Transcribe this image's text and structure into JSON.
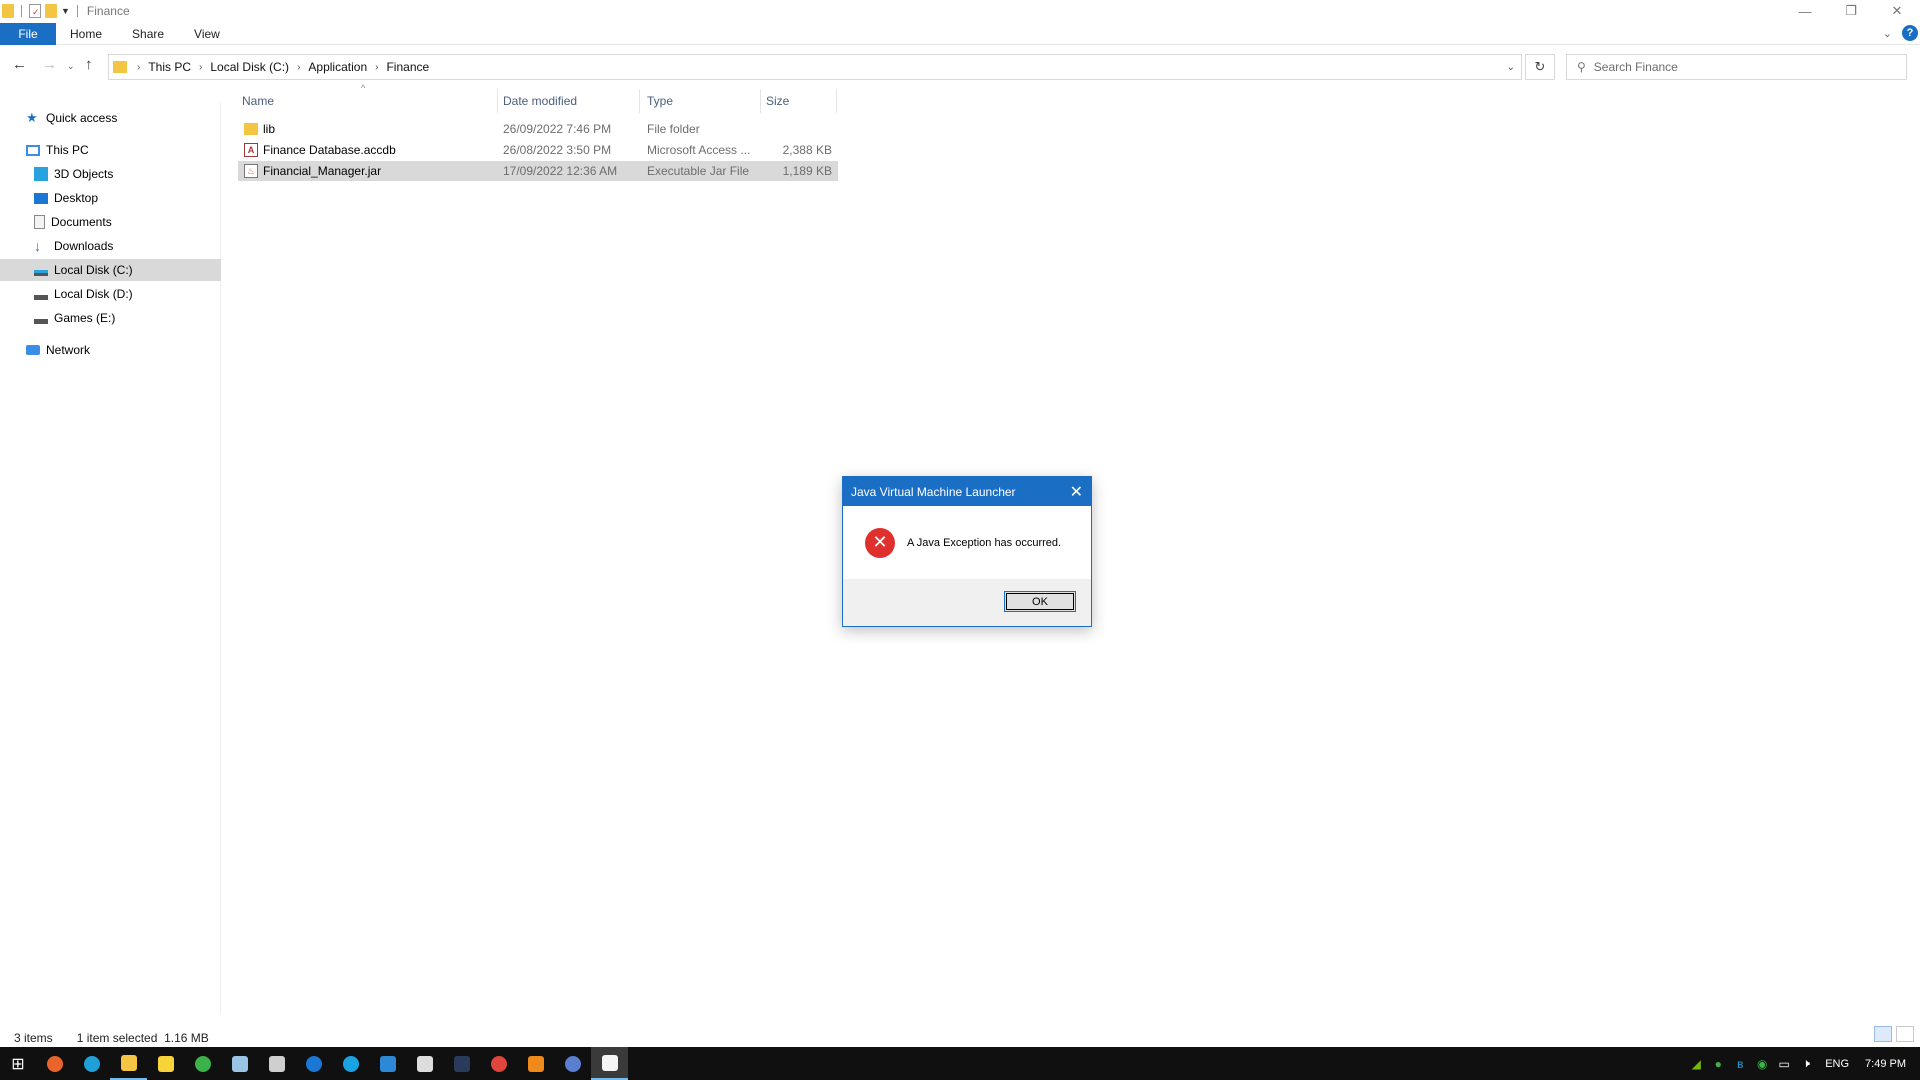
{
  "window": {
    "title": "Finance",
    "controls": {
      "minimize": "—",
      "maximize": "❐",
      "close": "✕"
    }
  },
  "ribbon": {
    "tabs": [
      "File",
      "Home",
      "Share",
      "View"
    ],
    "help": "?"
  },
  "address": {
    "crumbs": [
      "This PC",
      "Local Disk (C:)",
      "Application",
      "Finance"
    ]
  },
  "search": {
    "placeholder": "Search Finance"
  },
  "nav": {
    "items": [
      {
        "label": "Quick access",
        "icon": "star-icon"
      },
      {
        "label": "This PC",
        "icon": "pc-icon"
      },
      {
        "label": "3D Objects",
        "icon": "cube-icon"
      },
      {
        "label": "Desktop",
        "icon": "desktop-icon"
      },
      {
        "label": "Documents",
        "icon": "document-icon"
      },
      {
        "label": "Downloads",
        "icon": "download-icon"
      },
      {
        "label": "Local Disk (C:)",
        "icon": "drive-icon",
        "selected": true
      },
      {
        "label": "Local Disk (D:)",
        "icon": "drive-icon"
      },
      {
        "label": "Games (E:)",
        "icon": "drive-icon"
      },
      {
        "label": "Network",
        "icon": "network-icon"
      }
    ]
  },
  "columns": [
    "Name",
    "Date modified",
    "Type",
    "Size"
  ],
  "files": [
    {
      "name": "lib",
      "date": "26/09/2022 7:46 PM",
      "type": "File folder",
      "size": "",
      "icon": "folder-icon"
    },
    {
      "name": "Finance Database.accdb",
      "date": "26/08/2022 3:50 PM",
      "type": "Microsoft Access ...",
      "size": "2,388 KB",
      "icon": "access-file-icon"
    },
    {
      "name": "Financial_Manager.jar",
      "date": "17/09/2022 12:36 AM",
      "type": "Executable Jar File",
      "size": "1,189 KB",
      "icon": "jar-file-icon",
      "selected": true
    }
  ],
  "status": {
    "count": "3 items",
    "selection": "1 item selected  1.16 MB"
  },
  "dialog": {
    "title": "Java Virtual Machine Launcher",
    "message": "A Java Exception has occurred.",
    "ok": "OK",
    "close": "✕"
  },
  "tray": {
    "language": "ENG",
    "time": "7:49 PM"
  },
  "colors": {
    "accent": "#1a6fc4",
    "error": "#e0302d",
    "selection": "#d9d9d9"
  }
}
